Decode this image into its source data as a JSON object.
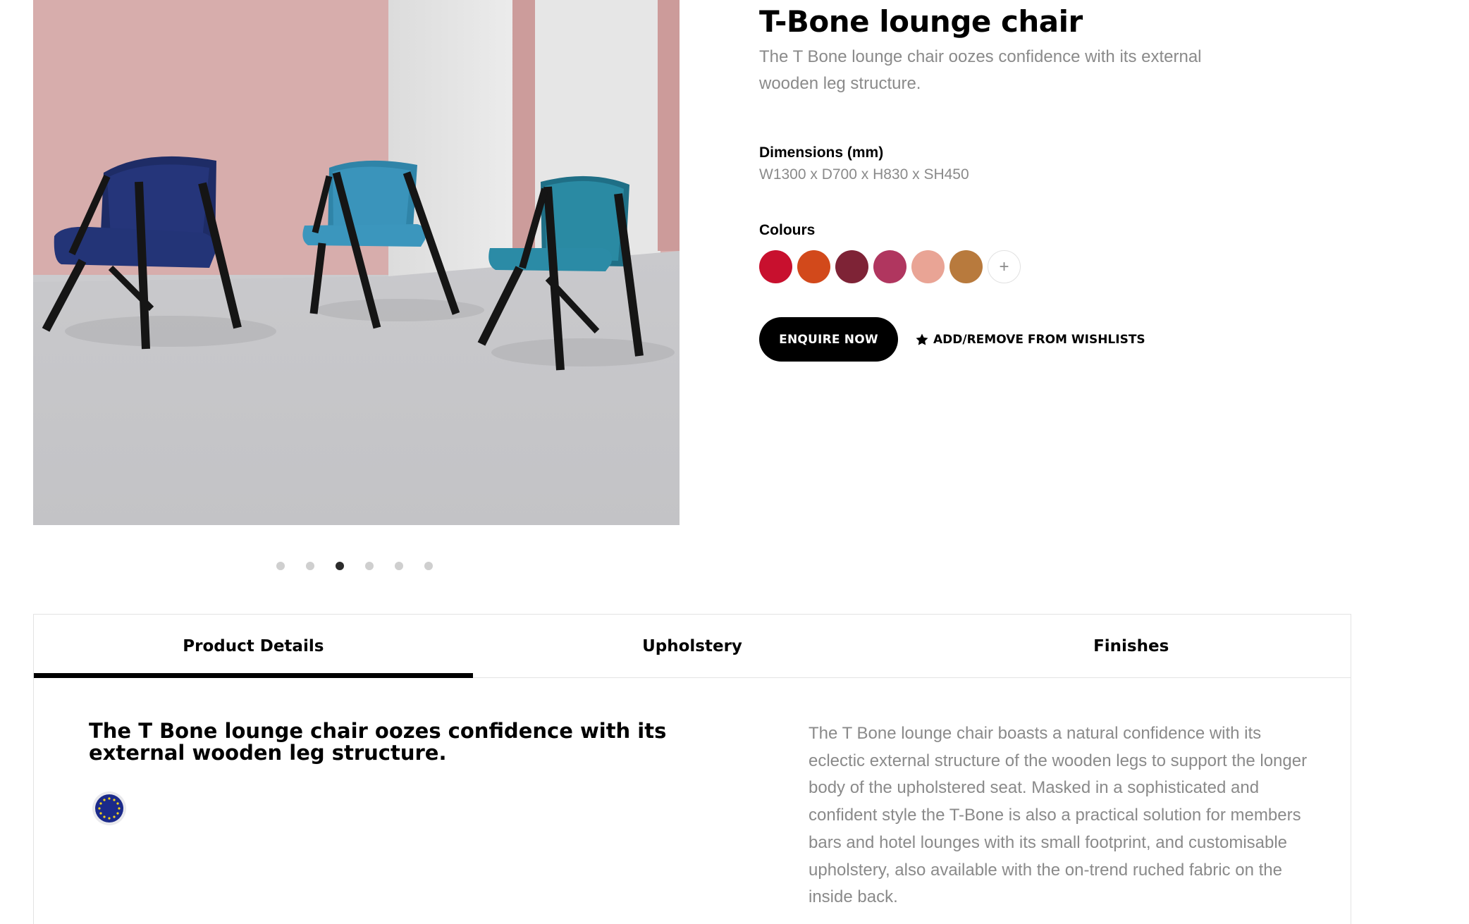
{
  "product": {
    "title": "T-Bone lounge chair",
    "subtitle": "The T Bone lounge chair oozes confidence with its external wooden leg structure.",
    "dimensions_label": "Dimensions (mm)",
    "dimensions_value": "W1300 x D700 x H830 x SH450",
    "colours_label": "Colours",
    "colours": [
      "#c8102e",
      "#d2491b",
      "#7e2336",
      "#b0365f",
      "#e9a495",
      "#b87a3d"
    ],
    "colours_more_label": "+",
    "enquire_label": "ENQUIRE NOW",
    "wishlist_label": "ADD/REMOVE FROM WISHLISTS"
  },
  "gallery": {
    "slide_count": 6,
    "active_slide": 3
  },
  "tabs": [
    {
      "label": "Product Details",
      "active": true
    },
    {
      "label": "Upholstery",
      "active": false
    },
    {
      "label": "Finishes",
      "active": false
    }
  ],
  "details": {
    "heading": "The T Bone lounge chair oozes confidence with its external wooden leg structure.",
    "body": "The T Bone lounge chair boasts a natural confidence with its eclectic external structure of the wooden legs to support the longer body of the upholstered seat. Masked in a sophisticated and confident style the T-Bone is also a practical solution for members bars and hotel lounges with its small footprint, and customisable upholstery, also available with the on-trend ruched fabric on the inside back."
  },
  "colors": {
    "accent": "#000000",
    "muted_text": "#8a8a8a",
    "badge_blue": "#1b2a8a"
  }
}
